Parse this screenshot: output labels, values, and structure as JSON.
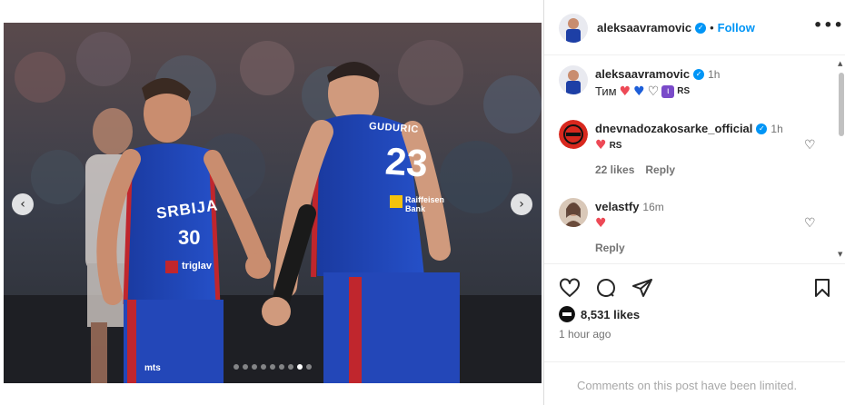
{
  "post": {
    "username": "aleksaavramovic",
    "follow_separator": "•",
    "follow_label": "Follow",
    "more_icon": "more-horizontal-icon",
    "media": {
      "jersey_country": "SRBIJA",
      "player_left_number": "30",
      "player_right_name": "GUDURIC",
      "player_right_number": "23",
      "sponsor_left": "triglav",
      "sponsor_right": "Raiffeisen Bank",
      "sponsor_bottom": "mts",
      "carousel_dots": 9,
      "active_dot_index": 7
    }
  },
  "comments": [
    {
      "username": "aleksaavramovic",
      "verified": true,
      "time": "1h",
      "text_prefix": "Тим",
      "emoji": [
        "red-heart",
        "blue-heart",
        "white-heart",
        "purple-box"
      ],
      "flag": "RS"
    },
    {
      "username": "dnevnadozakosarke_official",
      "verified": true,
      "time": "1h",
      "emoji": [
        "red-heart"
      ],
      "flag": "RS",
      "likes": "22 likes",
      "reply_label": "Reply"
    },
    {
      "username": "velastfy",
      "verified": false,
      "time": "16m",
      "emoji": [
        "red-heart"
      ],
      "reply_label": "Reply"
    }
  ],
  "actions": {
    "icons": [
      "heart-icon",
      "comment-icon",
      "share-icon",
      "bookmark-icon"
    ],
    "likes_text": "8,531 likes",
    "time_ago": "1 hour ago"
  },
  "limited_text": "Comments on this post have been limited.",
  "colors": {
    "accent": "#0095f6",
    "heart_red": "#ed4956",
    "jersey_blue": "#1d3fa6",
    "jersey_red": "#c0262d"
  }
}
